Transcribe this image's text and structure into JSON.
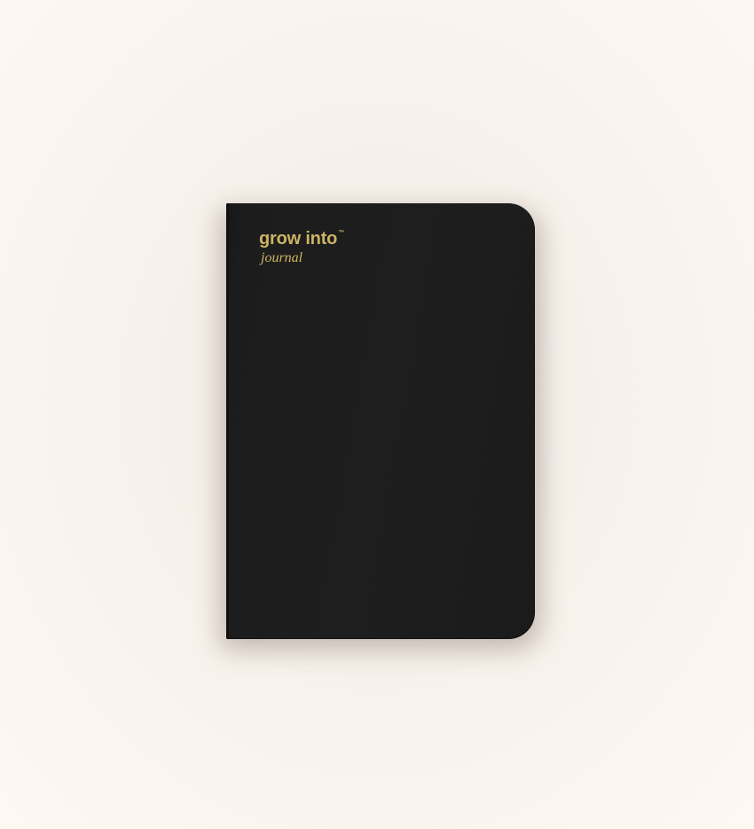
{
  "product": {
    "brand_name": "grow into",
    "trademark": "™",
    "subtitle": "journal"
  },
  "colors": {
    "background": "#f8f2ec",
    "notebook_cover": "#1c1c1c",
    "gold_foil": "#cdb463"
  }
}
